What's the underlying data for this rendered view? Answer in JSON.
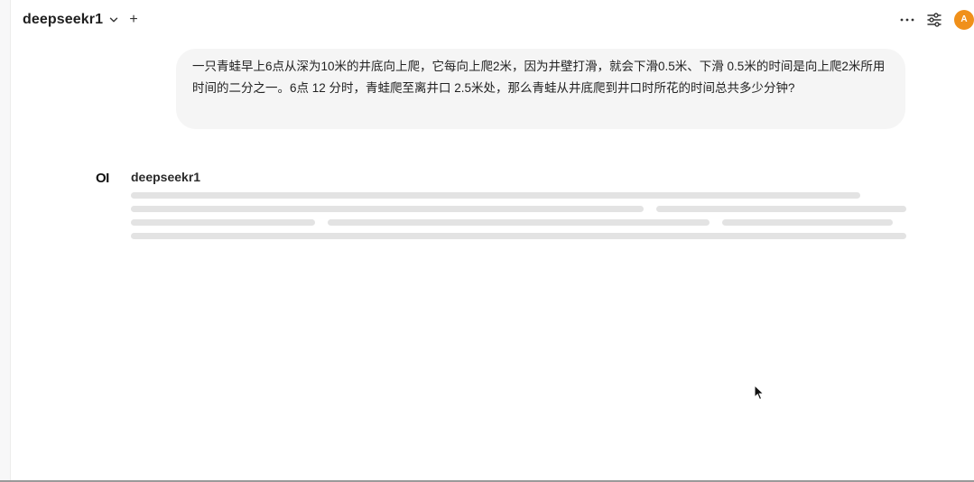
{
  "header": {
    "model_name": "deepseekr1",
    "new_chat_label": "+",
    "more_label": "more",
    "avatar_initial": "A",
    "avatar_color": "#f0901a"
  },
  "conversation": {
    "user_message": "一只青蛙早上6点从深为10米的井底向上爬，它每向上爬2米，因为井壁打滑，就会下滑0.5米、下滑 0.5米的时间是向上爬2米所用时间的二分之一。6点 12 分时，青蛙爬至离井口 2.5米处，那么青蛙从井底爬到井口时所花的时间总共多少分钟?",
    "assistant": {
      "logo_text": "OI",
      "name": "deepseekr1",
      "status": "loading"
    }
  },
  "colors": {
    "bubble_bg": "#f5f5f5",
    "skeleton": "#e3e3e3",
    "accent": "#f0901a"
  }
}
